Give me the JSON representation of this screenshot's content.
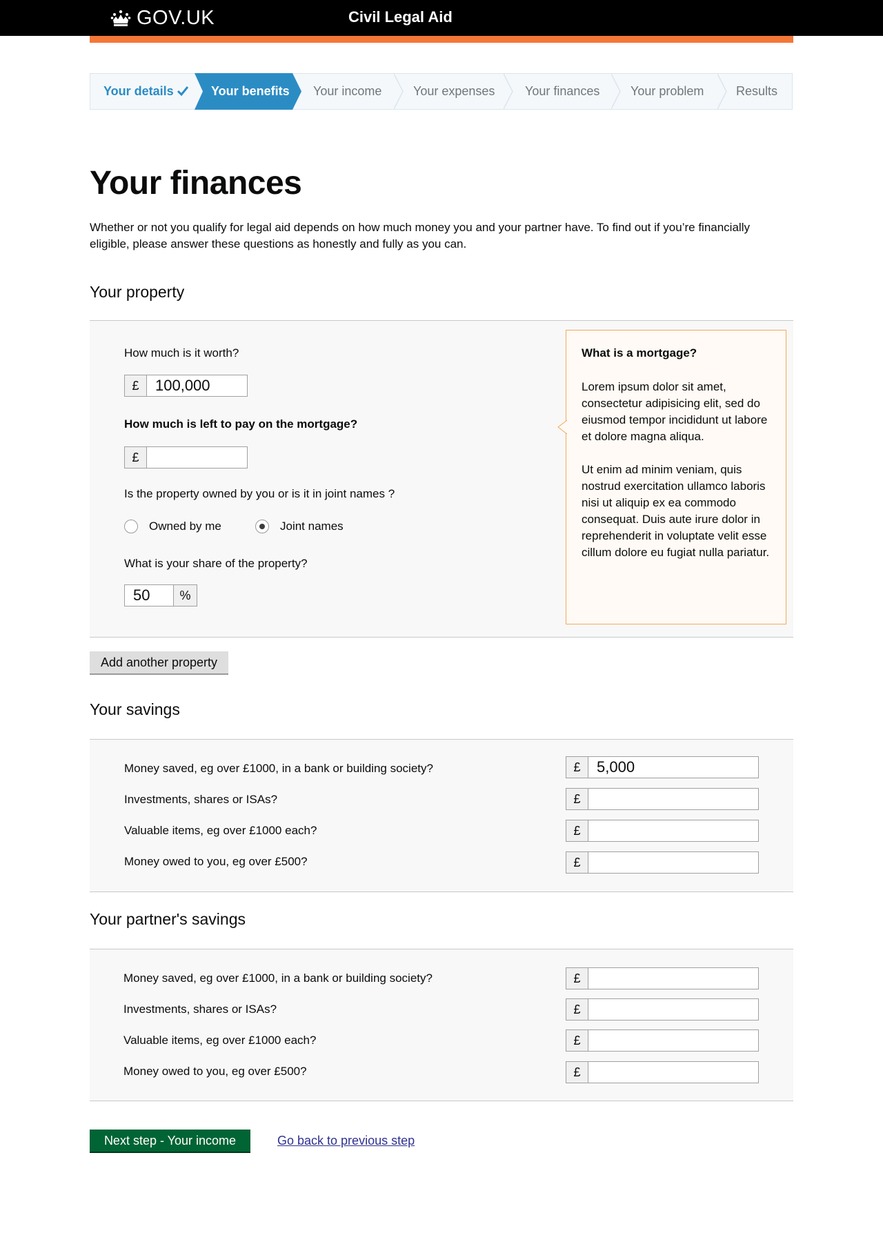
{
  "header": {
    "brand": "GOV.UK",
    "service_name": "Civil Legal Aid",
    "accent_color": "#f47738"
  },
  "steps": [
    {
      "label": "Your details",
      "state": "done"
    },
    {
      "label": "Your benefits",
      "state": "current"
    },
    {
      "label": "Your income",
      "state": "upcoming"
    },
    {
      "label": "Your expenses",
      "state": "upcoming"
    },
    {
      "label": "Your finances",
      "state": "upcoming"
    },
    {
      "label": "Your problem",
      "state": "upcoming"
    },
    {
      "label": "Results",
      "state": "upcoming"
    }
  ],
  "page": {
    "title": "Your finances",
    "intro": "Whether or not you qualify for legal aid depends on how much money you and your partner have. To find out if you’re financially eligible, please answer these questions as honestly and fully as you can."
  },
  "property": {
    "section_title": "Your property",
    "worth_label": "How much is it worth?",
    "worth_value": "100,000",
    "mortgage_label": "How much is left to pay on the mortgage?",
    "mortgage_value": "",
    "ownership_label": "Is the property owned by you or is it in joint names ?",
    "ownership_options": [
      "Owned by me",
      "Joint names"
    ],
    "ownership_selected": "Joint names",
    "share_label": "What is your share of the property?",
    "share_value": "50",
    "share_unit": "%",
    "currency_symbol": "£",
    "add_button": "Add another property"
  },
  "help": {
    "title": "What is a mortgage?",
    "paragraphs": [
      "Lorem ipsum dolor sit amet, consectetur adipisicing elit, sed do eiusmod tempor incididunt ut labore et dolore magna aliqua.",
      "Ut enim ad minim veniam, quis nostrud exercitation ullamco laboris nisi ut aliquip ex ea commodo consequat. Duis aute irure dolor in reprehenderit in voluptate velit esse cillum dolore eu fugiat nulla pariatur."
    ]
  },
  "savings": {
    "section_title": "Your savings",
    "currency_symbol": "£",
    "rows": [
      {
        "label": "Money saved, eg over £1000, in a bank or building society?",
        "value": "5,000"
      },
      {
        "label": "Investments, shares or ISAs?",
        "value": ""
      },
      {
        "label": "Valuable items, eg over £1000 each?",
        "value": ""
      },
      {
        "label": "Money owed to you, eg over £500?",
        "value": ""
      }
    ]
  },
  "partner_savings": {
    "section_title": "Your partner's savings",
    "currency_symbol": "£",
    "rows": [
      {
        "label": "Money saved, eg over £1000, in a bank or building society?",
        "value": ""
      },
      {
        "label": "Investments, shares or ISAs?",
        "value": ""
      },
      {
        "label": "Valuable items, eg over £1000 each?",
        "value": ""
      },
      {
        "label": "Money owed to you, eg over £500?",
        "value": ""
      }
    ]
  },
  "actions": {
    "next_button": "Next step - Your income",
    "back_link": "Go back to previous step"
  }
}
